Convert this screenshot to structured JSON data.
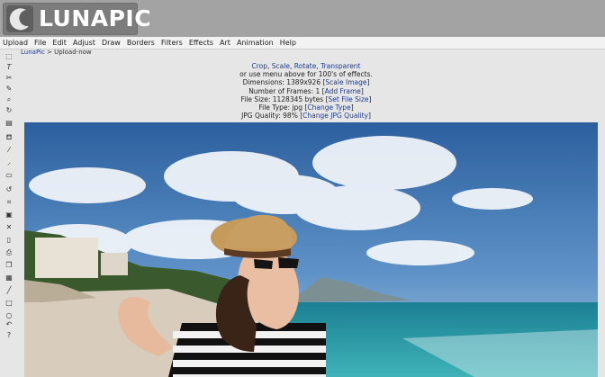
{
  "app": {
    "logo_text": "LUNAPIC"
  },
  "menu": [
    "Upload",
    "File",
    "Edit",
    "Adjust",
    "Draw",
    "Borders",
    "Filters",
    "Effects",
    "Art",
    "Animation",
    "Help"
  ],
  "breadcrumb": {
    "root": "LunaPic",
    "separator": " > ",
    "current": "Upload-now"
  },
  "info": {
    "links_line": {
      "crop": "Crop",
      "scale": "Scale",
      "rotate": "Rotate",
      "transparent": "Transparent"
    },
    "menu_hint": "or use menu above for 100's of effects.",
    "dimensions_label": "Dimensions: 1389x926",
    "scale_link": "Scale Image",
    "frames_label": "Number of Frames: 1",
    "add_frame_link": "Add Frame",
    "file_size_label": "File Size: 1128345 bytes",
    "set_file_size_link": "Set File Size",
    "file_type_label": "File Type: jpg",
    "change_type_link": "Change Type",
    "quality_label": "JPG Quality: 98%",
    "change_quality_link": "Change JPG Quality"
  },
  "colors": {
    "link": "#1f3b8f",
    "topbar": "#a3a3a3",
    "logo_bg": "#7c7c7c"
  },
  "tools": [
    "select-icon",
    "text-icon",
    "scissors-icon",
    "pencil-icon",
    "zoom-icon",
    "rotate-icon",
    "layers-icon",
    "paint-bucket-icon",
    "eyedropper-icon",
    "brush-icon",
    "folder-icon",
    "undo-arrow-icon",
    "crop-icon",
    "save-icon",
    "close-icon",
    "page-icon",
    "print-icon",
    "copy-icon",
    "images-icon",
    "line-icon",
    "square-icon",
    "circle-icon",
    "redo-icon",
    "help-icon"
  ]
}
